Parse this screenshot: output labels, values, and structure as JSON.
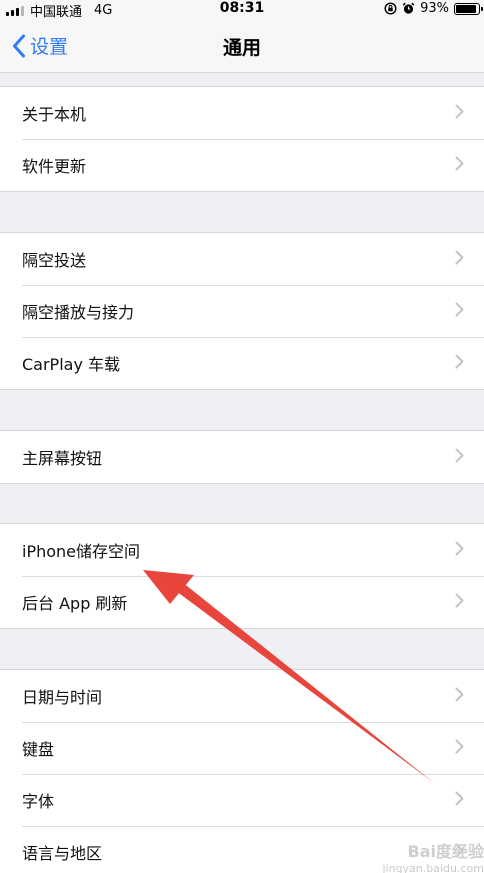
{
  "status_bar": {
    "carrier": "中国联通",
    "network": "4G",
    "time": "08:31",
    "battery": "93%",
    "battery_level": 0.93,
    "icons": [
      "signal-icon",
      "orientation-lock-icon",
      "alarm-icon",
      "battery-icon"
    ]
  },
  "nav": {
    "back_label": "设置",
    "title": "通用",
    "back_icon": "chevron-left-icon"
  },
  "groups": [
    {
      "items": [
        {
          "label": "关于本机"
        },
        {
          "label": "软件更新"
        }
      ]
    },
    {
      "items": [
        {
          "label": "隔空投送"
        },
        {
          "label": "隔空播放与接力"
        },
        {
          "label": "CarPlay 车载"
        }
      ]
    },
    {
      "items": [
        {
          "label": "主屏幕按钮"
        }
      ]
    },
    {
      "items": [
        {
          "label": "iPhone储存空间"
        },
        {
          "label": "后台 App 刷新"
        }
      ]
    },
    {
      "items": [
        {
          "label": "日期与时间"
        },
        {
          "label": "键盘"
        },
        {
          "label": "字体"
        },
        {
          "label": "语言与地区"
        }
      ]
    }
  ],
  "annotation": {
    "icon": "red-arrow-icon",
    "color": "#e8453c"
  },
  "watermark": {
    "brand": "Bai度经验",
    "url": "jingyan.baidu.com"
  },
  "colors": {
    "accent": "#2f7cf6",
    "background": "#efeff4",
    "chevron": "#c4c4c7"
  }
}
